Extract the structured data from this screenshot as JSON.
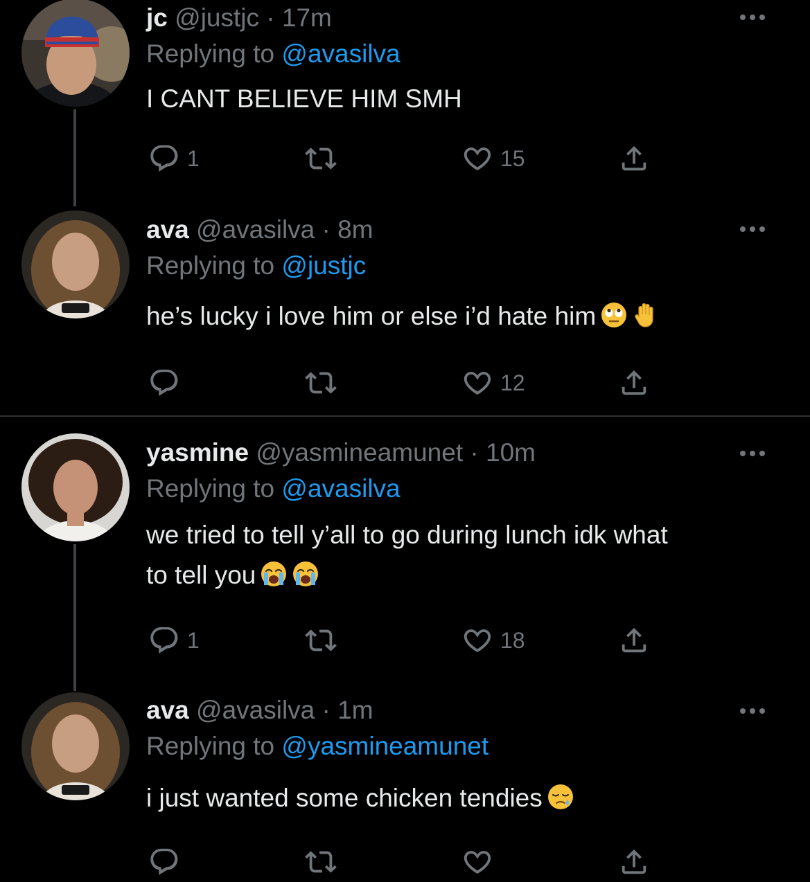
{
  "tweets": [
    {
      "name": "jc",
      "handle": "@justjc",
      "time": "· 17m",
      "replying_label": "Replying to",
      "replying_to": "@avasilva",
      "text": "I CANT BELIEVE HIM SMH",
      "emojis": [],
      "replies": "1",
      "retweets": "",
      "likes": "15"
    },
    {
      "name": "ava",
      "handle": "@avasilva",
      "time": "· 8m",
      "replying_label": "Replying to",
      "replying_to": "@justjc",
      "text": "he’s lucky i love him or else i’d hate him",
      "emojis": [
        "face-with-rolling-eyes",
        "raised-hand"
      ],
      "replies": "",
      "retweets": "",
      "likes": "12"
    },
    {
      "name": "yasmine",
      "handle": "@yasmineamunet",
      "time": "· 10m",
      "replying_label": "Replying to",
      "replying_to": "@avasilva",
      "text_line1": "we tried to tell y’all to go during lunch idk what",
      "text_line2": "to tell you",
      "emojis": [
        "loudly-crying-face",
        "loudly-crying-face"
      ],
      "replies": "1",
      "retweets": "",
      "likes": "18"
    },
    {
      "name": "ava",
      "handle": "@avasilva",
      "time": "· 1m",
      "replying_label": "Replying to",
      "replying_to": "@yasmineamunet",
      "text": "i just wanted some chicken tendies",
      "emojis": [
        "sleepy-face"
      ],
      "replies": "",
      "retweets": "",
      "likes": ""
    }
  ],
  "colors": {
    "background": "#000000",
    "text": "#e7e9ea",
    "muted": "#71767b",
    "link": "#1d9bf0",
    "divider": "#2f3336"
  }
}
